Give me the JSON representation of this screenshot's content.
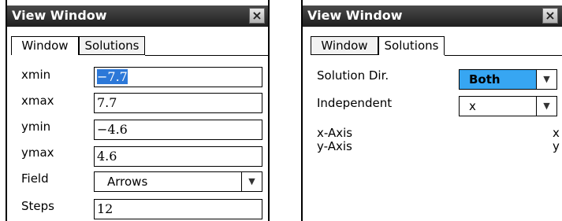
{
  "window_left": {
    "title": "View Window",
    "close_glyph": "×",
    "tabs": [
      {
        "label": "Window",
        "active": true
      },
      {
        "label": "Solutions",
        "active": false
      }
    ],
    "fields": {
      "xmin": {
        "label": "xmin",
        "value": "−7.7",
        "selected": true
      },
      "xmax": {
        "label": "xmax",
        "value": "7.7"
      },
      "ymin": {
        "label": "ymin",
        "value": "−4.6"
      },
      "ymax": {
        "label": "ymax",
        "value": "4.6"
      },
      "field": {
        "label": "Field",
        "value": "Arrows",
        "arrow": "▼"
      },
      "steps": {
        "label": "Steps",
        "value": "12"
      }
    }
  },
  "window_right": {
    "title": "View Window",
    "close_glyph": "×",
    "tabs": [
      {
        "label": "Window",
        "active": false
      },
      {
        "label": "Solutions",
        "active": true
      }
    ],
    "solution_dir": {
      "label": "Solution Dir.",
      "value": "Both",
      "arrow": "▼",
      "highlight_color": "#37a6f2"
    },
    "independent": {
      "label": "Independent",
      "value": "x",
      "arrow": "▼"
    },
    "x_axis": {
      "label": "x-Axis",
      "value": "x"
    },
    "y_axis": {
      "label": "y-Axis",
      "value": "y"
    }
  }
}
